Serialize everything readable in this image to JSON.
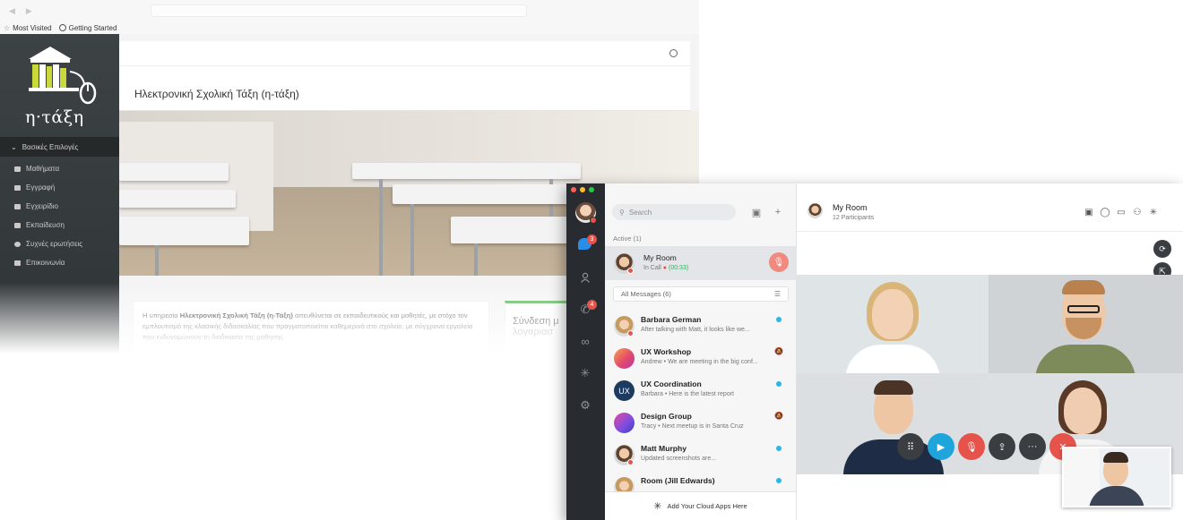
{
  "browser": {
    "bookmarks": [
      {
        "label": "Most Visited"
      },
      {
        "label": "Getting Started"
      }
    ]
  },
  "eclass": {
    "logo_text": "η·τάξη",
    "menu_header": "Βασικές Επιλογές",
    "menu": [
      {
        "label": "Μαθήματα",
        "icon": "book-icon"
      },
      {
        "label": "Εγγραφή",
        "icon": "edit-icon"
      },
      {
        "label": "Εγχειρίδιο",
        "icon": "manual-icon"
      },
      {
        "label": "Εκπαίδευση",
        "icon": "training-icon"
      },
      {
        "label": "Συχνές ερωτήσεις",
        "icon": "question-icon"
      },
      {
        "label": "Επικοινωνία",
        "icon": "phone-icon"
      }
    ],
    "page_title": "Ηλεκτρονική Σχολική Τάξη (η-τάξη)",
    "info_prefix": "Η υπηρεσία ",
    "info_bold": "Ηλεκτρονική Σχολική Τάξη (η-Τάξη)",
    "info_rest": " απευθύνεται σε εκπαιδευτικούς και μαθητές, με στόχο τον εμπλουτισμό της κλασικής διδασκαλίας που πραγματοποιείται καθημερινά στο σχολείο, με σύγχρονα εργαλεία που ενδυναμώνουν τη διαδικασία της μάθησης.",
    "login_title": "Σύνδεση μ",
    "login_sub": "λογαριασ"
  },
  "chat": {
    "search_placeholder": "Search",
    "active_label": "Active (1)",
    "active_room": {
      "title": "My Room",
      "status": "In Call",
      "time": "(00:33)"
    },
    "filter_label": "All Messages (6)",
    "conversations": [
      {
        "title": "Barbara German",
        "preview": "After talking with Matt, it looks like we...",
        "avatar": "face-f",
        "indicator": "unread"
      },
      {
        "title": "UX Workshop",
        "preview": "Andrew • We are meeting in the big conf...",
        "avatar": "ux",
        "indicator": "muted"
      },
      {
        "title": "UX Coordination",
        "preview": "Barbara • Here is the latest report",
        "avatar": "uxc",
        "avatar_text": "UX",
        "indicator": "unread"
      },
      {
        "title": "Design Group",
        "preview": "Tracy • Next meetup is in Santa Cruz",
        "avatar": "design",
        "indicator": "muted"
      },
      {
        "title": "Matt Murphy",
        "preview": "Updated screenshots are...",
        "avatar": "face-m",
        "indicator": "unread"
      },
      {
        "title": "Room (Jill Edwards)",
        "preview": "",
        "avatar": "face-f",
        "indicator": "unread"
      }
    ],
    "cloud_apps_label": "Add Your Cloud Apps Here",
    "rail_badges": [
      "3",
      "4"
    ],
    "room": {
      "title": "My Room",
      "participants": "12 Participants"
    }
  },
  "colors": {
    "accent_blue": "#2a8ee8",
    "call_red": "#e5534b",
    "online_green": "#2db55d",
    "unread_cyan": "#29b6e8",
    "login_green": "#5cb85c"
  }
}
